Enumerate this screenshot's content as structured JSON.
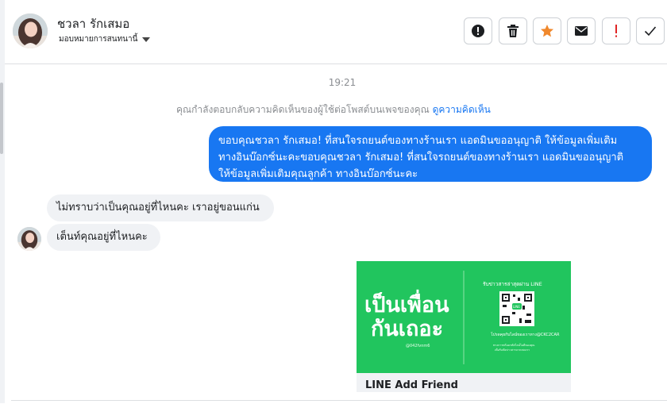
{
  "contact": {
    "name": "ชวลา รักเสมอ",
    "assign_label": "มอบหมายการสนทนานี้"
  },
  "header_actions": [
    {
      "icon": "alert-circle-icon"
    },
    {
      "icon": "trash-icon"
    },
    {
      "icon": "star-icon",
      "color": "#f0882c"
    },
    {
      "icon": "envelope-icon"
    },
    {
      "icon": "exclamation-icon",
      "color": "#e02424"
    },
    {
      "icon": "check-icon"
    }
  ],
  "conversation": {
    "timestamp": "19:21",
    "reply_note": "คุณกำลังตอบกลับความคิดเห็นของผู้ใช้ต่อโพสต์บนเพจของคุณ",
    "reply_link": "ดูความคิดเห็น",
    "outgoing": [
      {
        "lines": [
          "ขอบคุณชวลา รักเสมอ! ที่สนใจรถยนต์ของทางร้านเรา แอดมินขออนุญาติ ให้ข้อมูลเพิ่มเติม",
          "ทางอินบ๊อกซ์นะคะขอบคุณชวลา รักเสมอ! ที่สนใจรถยนต์ของทางร้านเรา แอดมินขออนุญาติ",
          "ให้ข้อมูลเพิ่มเติมคุณลูกค้า ทางอินบ๊อกซ์นะคะ"
        ]
      }
    ],
    "incoming": [
      {
        "text": "ไม่ทราบว่าเป็นคุณอยู่ที่ไหนคะ เราอยู่ขอนแก่น"
      },
      {
        "text": "เต็นท์คุณอยู่ที่ไหนคะ"
      }
    ],
    "card": {
      "title": "LINE Add Friend",
      "image_big_line1": "เป็นเพื่อน",
      "image_big_line2": "กันเถอะ",
      "image_id": "@042fvnm6",
      "image_heading": "รับข่าวสารล่าสุดผ่าน LINE",
      "qr_label": "LINE",
      "image_caption": "โปรดคุยกับไลน์ของเราทาง@CKC2CAR",
      "image_small_1": "ทางการพร้อมรหัสไลน์ไอดีของคุณ",
      "image_small_2": "เพื่อรับฟังข่าวสารจากเพจเรา",
      "bg_color": "#21c55e"
    }
  },
  "colors": {
    "accent": "#1877f2",
    "bubble_in": "#f0f2f5"
  }
}
